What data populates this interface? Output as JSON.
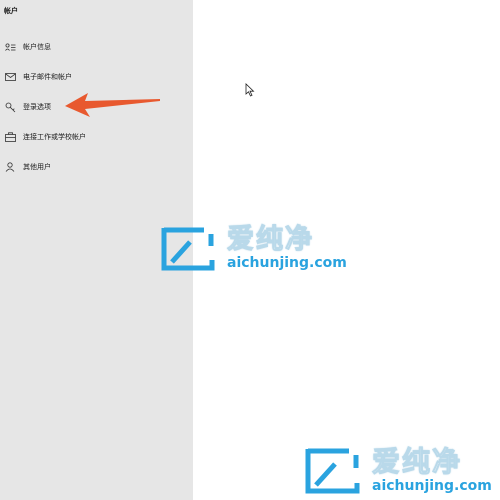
{
  "sidebar": {
    "title": "帐户",
    "items": [
      {
        "label": "帐户信息",
        "icon": "account-info-icon"
      },
      {
        "label": "电子邮件和帐户",
        "icon": "mail-icon"
      },
      {
        "label": "登录选项",
        "icon": "key-icon"
      },
      {
        "label": "连接工作或学校帐户",
        "icon": "briefcase-icon"
      },
      {
        "label": "其他用户",
        "icon": "person-icon"
      }
    ]
  },
  "annotation": {
    "arrow_color": "#e8592f"
  },
  "watermark": {
    "chinese": "爱纯净",
    "domain": "aichunjing.com",
    "accent_color": "#2aa3df"
  }
}
